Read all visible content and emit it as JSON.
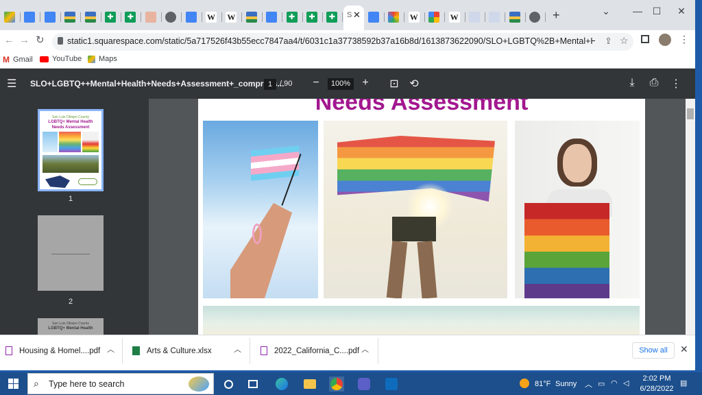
{
  "browser": {
    "tab_icons": [
      "drive-icon",
      "docs-icon",
      "docs-icon",
      "photo-icon",
      "photo-icon",
      "sheets-icon",
      "sheets-icon",
      "plus-icon",
      "globe-icon",
      "docs-icon",
      "wikipedia-icon",
      "wikipedia-icon",
      "photo-icon",
      "docs-icon",
      "sheets-icon",
      "sheets-icon",
      "sheets-icon"
    ],
    "active_tab_label": "S",
    "tab_icons_right": [
      "docs-icon",
      "flower-icon",
      "wikipedia-icon",
      "google-icon",
      "wikipedia-icon",
      "file-icon",
      "file-icon",
      "photo-icon",
      "globe-icon"
    ],
    "new_tab_label": "+",
    "url": "static1.squarespace.com/static/5a717526f43b55ecc7847aa4/t/6031c1a37738592b37a16b8d/1613873622090/SLO+LGBTQ%2B+Mental+Health+Needs+A...",
    "bookmarks": [
      {
        "label": "Gmail",
        "icon": "gmail-icon"
      },
      {
        "label": "YouTube",
        "icon": "youtube-icon"
      },
      {
        "label": "Maps",
        "icon": "maps-icon"
      }
    ]
  },
  "pdf": {
    "title": "SLO+LGBTQ++Mental+Health+Needs+Assessment+_compress...",
    "current_page": "1",
    "total_pages": "/ 90",
    "zoom": "100%",
    "page_heading": "Needs Assessment",
    "thumbnails": [
      {
        "label": "1",
        "lines": [
          "San Luis Obispo County",
          "LGBTQ+ Mental Health",
          "Needs Assessment"
        ]
      },
      {
        "label": "2"
      },
      {
        "label": "",
        "lines": [
          "San Luis Obispo County",
          "LGBTQ+ Mental Health"
        ]
      }
    ]
  },
  "downloads": {
    "items": [
      {
        "name": "Housing & Homel....pdf",
        "icon": "pdf-icon"
      },
      {
        "name": "Arts & Culture.xlsx",
        "icon": "excel-icon"
      },
      {
        "name": "2022_California_C....pdf",
        "icon": "pdf-icon"
      }
    ],
    "show_all": "Show all"
  },
  "taskbar": {
    "search_placeholder": "Type here to search",
    "weather_temp": "81°F",
    "weather_desc": "Sunny",
    "time": "2:02 PM",
    "date": "6/28/2022"
  },
  "colors": {
    "heading_magenta": "#a2188f",
    "pdf_toolbar": "#323639",
    "taskbar": "#1c4f8c"
  }
}
